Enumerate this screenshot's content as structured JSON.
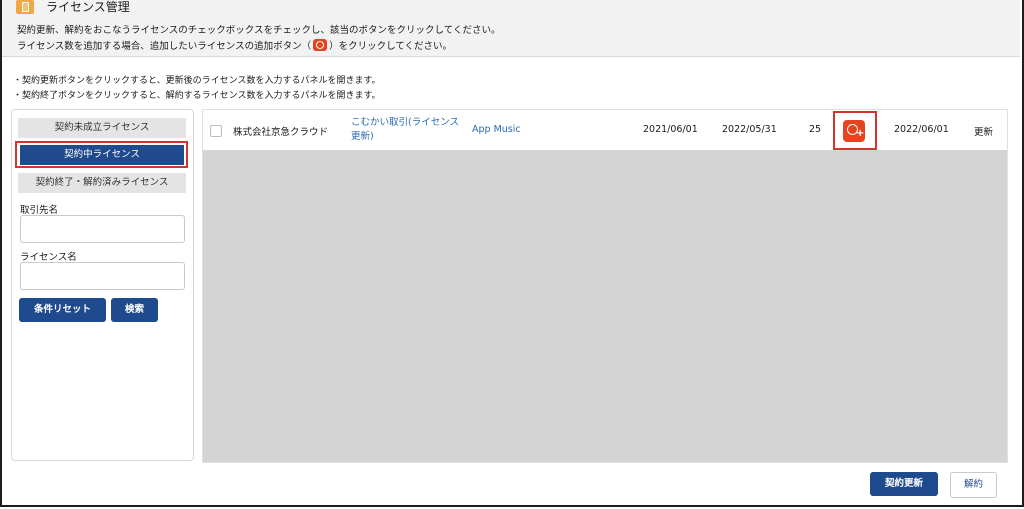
{
  "header": {
    "app_icon": "license-book-icon",
    "title": "ライセンス管理",
    "instruction_line1": "契約更新、解約をおこなうライセンスのチェックボックスをチェックし、該当のボタンをクリックしてください。",
    "instruction_line2_before": "ライセンス数を追加する場合、追加したいライセンスの追加ボタン（",
    "instruction_line2_after": "）をクリックしてください。"
  },
  "notes": {
    "line1": "・契約更新ボタンをクリックすると、更新後のライセンス数を入力するパネルを開きます。",
    "line2": "・契約終了ボタンをクリックすると、解約するライセンス数を入力するパネルを開きます。"
  },
  "sidebar": {
    "tabs": [
      {
        "label": "契約未成立ライセンス"
      },
      {
        "label": "契約中ライセンス"
      },
      {
        "label": "契約終了・解約済みライセンス"
      }
    ],
    "partner_label": "取引先名",
    "partner_value": "",
    "license_label": "ライセンス名",
    "license_value": "",
    "reset_label": "条件リセット",
    "search_label": "検索"
  },
  "rows": [
    {
      "company": "株式会社京急クラウド",
      "deal": "こむかい取引(ライセンス更新)",
      "product": "App Music",
      "start": "2021/06/01",
      "end": "2022/05/31",
      "count": "25",
      "next": "2022/06/01",
      "status": "更新"
    }
  ],
  "footer": {
    "renew_label": "契約更新",
    "cancel_label": "解約"
  },
  "colors": {
    "primary": "#1f4a8d",
    "accent": "#e8431f",
    "highlight": "#d2352b"
  }
}
